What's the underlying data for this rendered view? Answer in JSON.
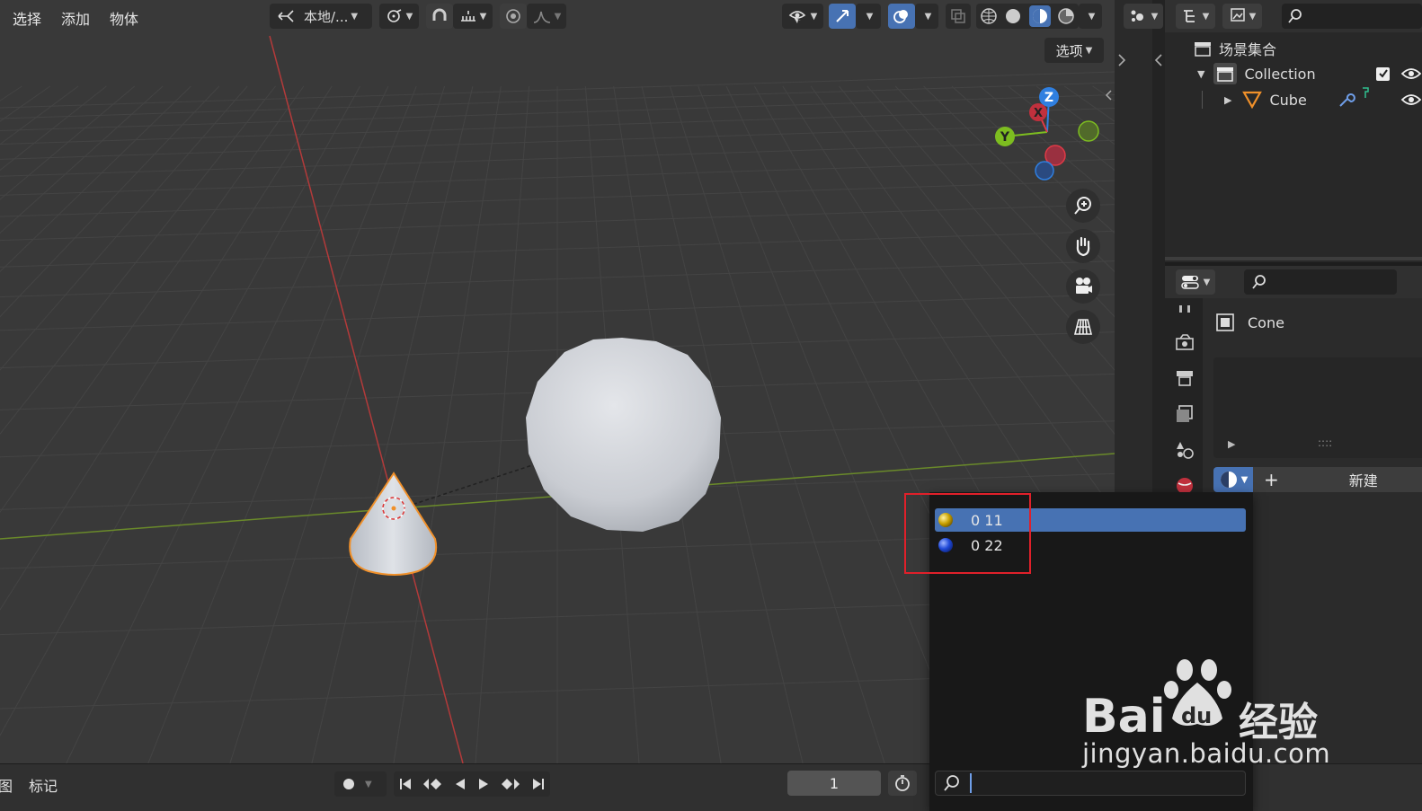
{
  "menu": {
    "select": "选择",
    "add": "添加",
    "object": "物体"
  },
  "header": {
    "transform_orientation": "本地/...",
    "options_label": "选项"
  },
  "gizmo": {
    "z": "Z",
    "x": "X",
    "y": "Y"
  },
  "outliner": {
    "scene_collection": "场景集合",
    "collection": "Collection",
    "cube": "Cube"
  },
  "properties": {
    "object_name": "Cone",
    "new_label": "新建",
    "add_symbol": "+",
    "list_grip": "::::"
  },
  "popup": {
    "items": [
      {
        "label": "0 11",
        "color": "#c8a000",
        "active": true
      },
      {
        "label": "0 22",
        "color": "#1f49d8",
        "active": false
      }
    ],
    "search_placeholder": ""
  },
  "timeline": {
    "view_label": "图",
    "markers_label": "标记",
    "current_frame": "1"
  },
  "watermark": {
    "brand_suffix": "经验",
    "url": "jingyan.baidu.com"
  },
  "colors": {
    "accent_blue": "#4772b3",
    "selection_orange": "#f0902a",
    "highlight_red": "#e0202a",
    "axis_x": "#e03a46",
    "axis_y": "#7dbd20",
    "axis_z": "#2f7fe0"
  }
}
